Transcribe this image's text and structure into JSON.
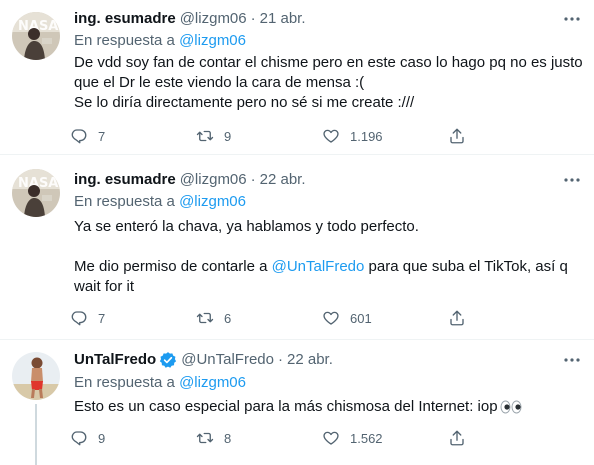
{
  "tweets": [
    {
      "name": "ing. esumadre",
      "handle": "@lizgm06",
      "separator": "·",
      "date": "21 abr.",
      "reply_prefix": "En respuesta a",
      "reply_to": "@lizgm06",
      "lines": [
        "De vdd soy fan de contar el chisme pero en este caso lo hago pq no es justo",
        "que el Dr le este viendo la cara de mensa :(",
        "Se lo diría directamente pero no sé si me create :///"
      ],
      "replies": "7",
      "retweets": "9",
      "likes": "1.196"
    },
    {
      "name": "ing. esumadre",
      "handle": "@lizgm06",
      "separator": "·",
      "date": "22 abr.",
      "reply_prefix": "En respuesta a",
      "reply_to": "@lizgm06",
      "line1": "Ya se enteró la chava, ya hablamos y todo perfecto.",
      "line3_before": "Me dio permiso de contarle a ",
      "line3_mention": "@UnTalFredo",
      "line3_after": " para que suba el TikTok, así q",
      "line4": "wait for it",
      "replies": "7",
      "retweets": "6",
      "likes": "601"
    },
    {
      "name": "UnTalFredo",
      "handle": "@UnTalFredo",
      "separator": "·",
      "date": "22 abr.",
      "reply_prefix": "En respuesta a",
      "reply_to": "@lizgm06",
      "line1": "Esto es un caso especial para la más chismosa del Internet: iop",
      "replies": "9",
      "retweets": "8",
      "likes": "1.562"
    }
  ],
  "colors": {
    "text": "#0f1419",
    "secondary": "#536471",
    "link": "#1d9bf0",
    "border": "#eff3f4",
    "verified": "#1d9bf0"
  },
  "icons": [
    "more-icon",
    "reply-icon",
    "retweet-icon",
    "like-icon",
    "share-icon",
    "verified-badge-icon",
    "eyes-emoji-icon"
  ]
}
